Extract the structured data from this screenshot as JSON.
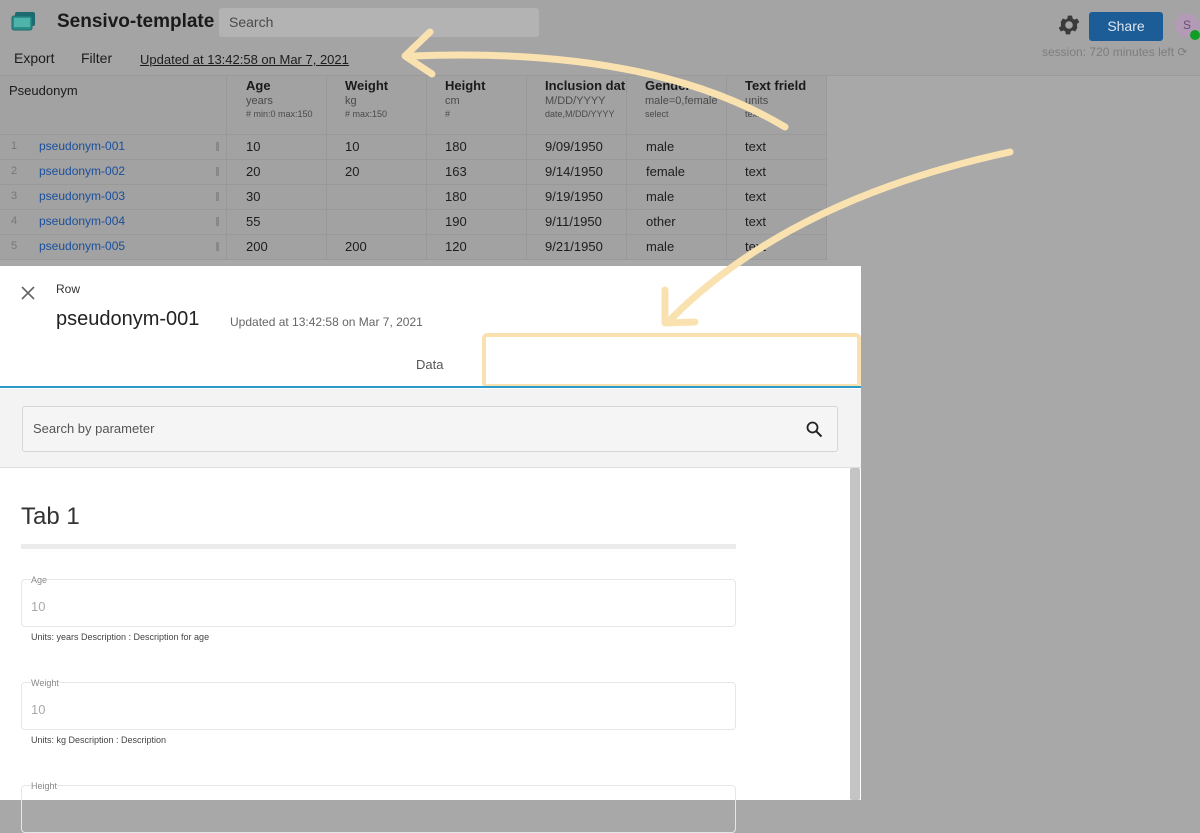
{
  "app": {
    "title": "Sensivo-template",
    "search_placeholder": "Search",
    "menu": [
      "Export",
      "Filter"
    ],
    "updated_link": "Updated at 13:42:58 on Mar 7, 2021",
    "share_label": "Share",
    "avatar_initial": "S",
    "session_text": "session: 720 minutes left",
    "icons": [
      "logo-icon",
      "gear-icon",
      "reload-icon"
    ],
    "colors": {
      "share": "#1c5d97",
      "online": "#0f9d26",
      "link": "#1a4f9c",
      "tab_underline": "#2a9ccb",
      "highlight": "#fae2b0"
    }
  },
  "grid": {
    "first_col_header": "Pseudonym",
    "columns": [
      {
        "title": "Age",
        "unit": "years",
        "type": "# min:0 max:150"
      },
      {
        "title": "Weight",
        "unit": "kg",
        "type": "# max:150"
      },
      {
        "title": "Height",
        "unit": "cm",
        "type": "#"
      },
      {
        "title": "Inclusion dat",
        "unit": "M/DD/YYYY",
        "type": "date,M/DD/YYYY"
      },
      {
        "title": "Gender",
        "unit": "male=0,female",
        "type": "select"
      },
      {
        "title": "Text frield",
        "unit": "units",
        "type": "text"
      }
    ],
    "rows": [
      {
        "num": "1",
        "name": "pseudonym-001",
        "cells": [
          "10",
          "10",
          "180",
          "9/09/1950",
          "male",
          "text"
        ]
      },
      {
        "num": "2",
        "name": "pseudonym-002",
        "cells": [
          "20",
          "20",
          "163",
          "9/14/1950",
          "female",
          "text"
        ]
      },
      {
        "num": "3",
        "name": "pseudonym-003",
        "cells": [
          "30",
          "",
          "180",
          "9/19/1950",
          "male",
          "text"
        ]
      },
      {
        "num": "4",
        "name": "pseudonym-004",
        "cells": [
          "55",
          "",
          "190",
          "9/11/1950",
          "other",
          "text"
        ]
      },
      {
        "num": "5",
        "name": "pseudonym-005",
        "cells": [
          "200",
          "200",
          "120",
          "9/21/1950",
          "male",
          "text"
        ]
      }
    ]
  },
  "panel": {
    "label": "Row",
    "name": "pseudonym-001",
    "updated": "Updated at 13:42:58 on Mar 7, 2021",
    "tab_data": "Data",
    "search_placeholder": "Search by parameter",
    "section_title": "Tab 1",
    "fields": [
      {
        "label": "Age",
        "value": "10",
        "help": "Units: years Description : Description for age"
      },
      {
        "label": "Weight",
        "value": "10",
        "help": "Units: kg Description : Description"
      },
      {
        "label": "Height",
        "value": "",
        "help": ""
      }
    ]
  }
}
